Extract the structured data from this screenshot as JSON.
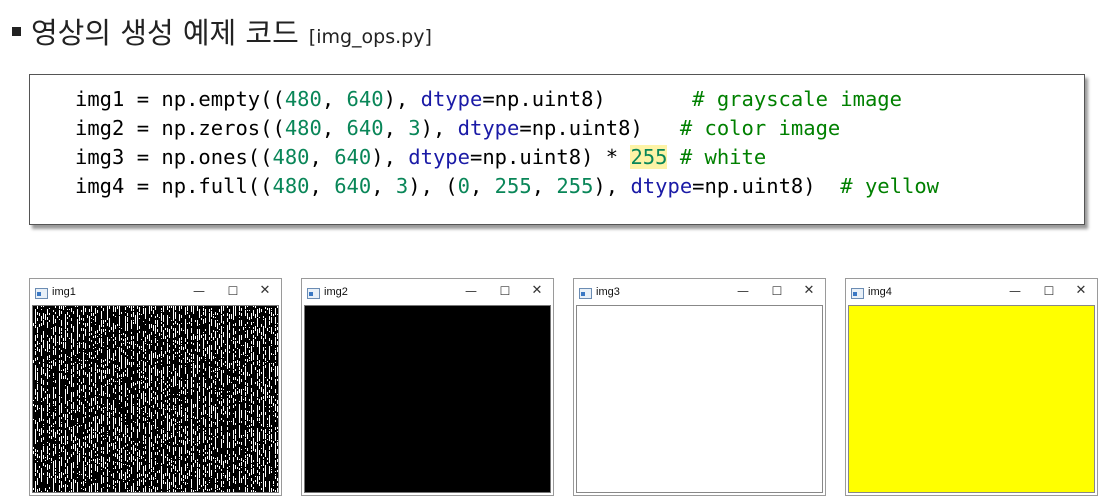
{
  "heading": {
    "title": "영상의 생성 예제 코드",
    "file": "[img_ops.py]"
  },
  "code": {
    "lines": [
      [
        {
          "t": "img1 = np.empty(("
        },
        {
          "t": "480",
          "c": "num"
        },
        {
          "t": ", "
        },
        {
          "t": "640",
          "c": "num"
        },
        {
          "t": "), "
        },
        {
          "t": "dtype",
          "c": "kw"
        },
        {
          "t": "=np.uint8)       "
        },
        {
          "t": "# grayscale image",
          "c": "cm"
        }
      ],
      [
        {
          "t": "img2 = np.zeros(("
        },
        {
          "t": "480",
          "c": "num"
        },
        {
          "t": ", "
        },
        {
          "t": "640",
          "c": "num"
        },
        {
          "t": ", "
        },
        {
          "t": "3",
          "c": "num"
        },
        {
          "t": "), "
        },
        {
          "t": "dtype",
          "c": "kw"
        },
        {
          "t": "=np.uint8)   "
        },
        {
          "t": "# color image",
          "c": "cm"
        }
      ],
      [
        {
          "t": "img3 = np.ones(("
        },
        {
          "t": "480",
          "c": "num"
        },
        {
          "t": ", "
        },
        {
          "t": "640",
          "c": "num"
        },
        {
          "t": "), "
        },
        {
          "t": "dtype",
          "c": "kw"
        },
        {
          "t": "=np.uint8) * "
        },
        {
          "t": "255",
          "c": "hl"
        },
        {
          "t": " "
        },
        {
          "t": "# white",
          "c": "cm"
        }
      ],
      [
        {
          "t": "img4 = np.full(("
        },
        {
          "t": "480",
          "c": "num"
        },
        {
          "t": ", "
        },
        {
          "t": "640",
          "c": "num"
        },
        {
          "t": ", "
        },
        {
          "t": "3",
          "c": "num"
        },
        {
          "t": "), ("
        },
        {
          "t": "0",
          "c": "num"
        },
        {
          "t": ", "
        },
        {
          "t": "255",
          "c": "num"
        },
        {
          "t": ", "
        },
        {
          "t": "255",
          "c": "num"
        },
        {
          "t": "), "
        },
        {
          "t": "dtype",
          "c": "kw"
        },
        {
          "t": "=np.uint8)  "
        },
        {
          "t": "# yellow",
          "c": "cm"
        }
      ]
    ]
  },
  "window_controls": {
    "minimize": "—",
    "maximize": "☐",
    "close": "✕"
  },
  "windows": [
    {
      "title": "img1",
      "fill": "noise"
    },
    {
      "title": "img2",
      "fill": "#000000"
    },
    {
      "title": "img3",
      "fill": "#ffffff"
    },
    {
      "title": "img4",
      "fill": "#ffff00"
    }
  ],
  "colors": {
    "number": "#098658",
    "keyword": "#1a1aa6",
    "comment": "#008000",
    "highlight": "#fdf3a6"
  }
}
